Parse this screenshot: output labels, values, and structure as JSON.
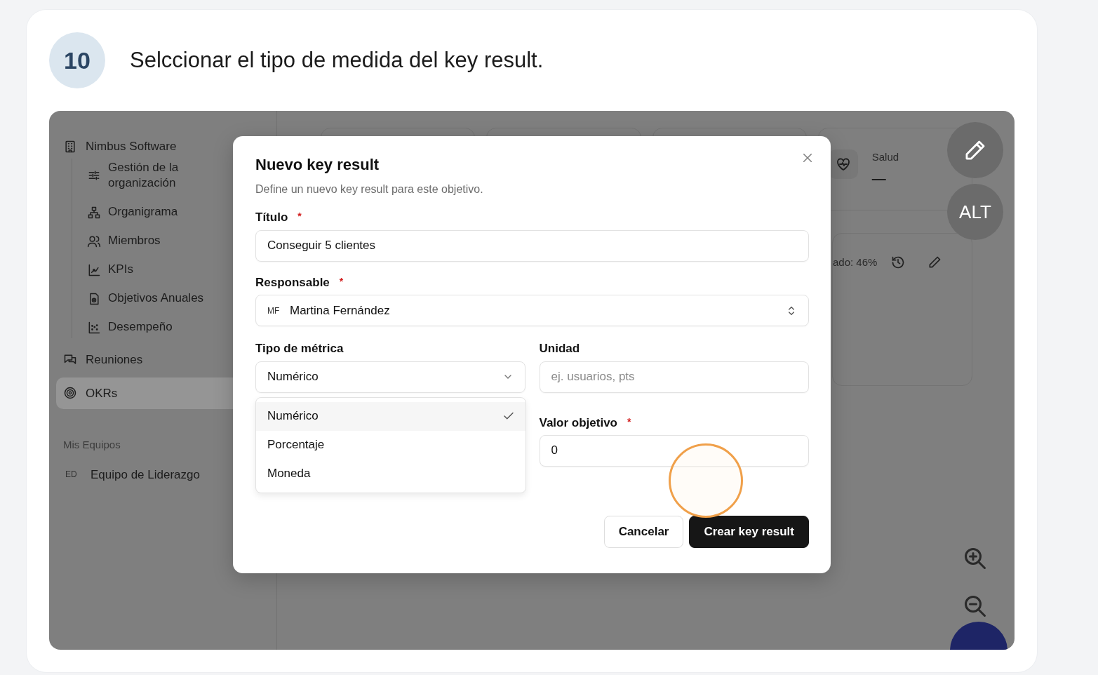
{
  "step": {
    "number": "10",
    "text": "Selccionar el tipo de medida del key result."
  },
  "sidebar": {
    "workspace": "Nimbus Software",
    "children": [
      {
        "label": "Gestión de la organización"
      },
      {
        "label": "Organigrama"
      },
      {
        "label": "Miembros"
      },
      {
        "label": "KPIs"
      },
      {
        "label": "Objetivos Anuales"
      },
      {
        "label": "Desempeño"
      }
    ],
    "items": [
      {
        "label": "Reuniones",
        "selected": false
      },
      {
        "label": "OKRs",
        "selected": true
      }
    ],
    "section": "Mis Equipos",
    "teams": [
      {
        "initials": "ED",
        "name": "Equipo de Liderazgo"
      }
    ]
  },
  "background": {
    "health_label": "Salud",
    "health_value": "—",
    "progress_text": "ado: 46%"
  },
  "modal": {
    "title": "Nuevo key result",
    "subtitle": "Define un nuevo key result para este objetivo.",
    "title_field": {
      "label": "Título",
      "required_mark": "*",
      "value": "Conseguir 5 clientes"
    },
    "owner_field": {
      "label": "Responsable",
      "required_mark": "*",
      "initials": "MF",
      "value": "Martina Fernández"
    },
    "metric_field": {
      "label": "Tipo de métrica",
      "value": "Numérico",
      "expanded": true,
      "options": [
        {
          "label": "Numérico",
          "selected": true
        },
        {
          "label": "Porcentaje",
          "selected": false
        },
        {
          "label": "Moneda",
          "selected": false
        }
      ]
    },
    "unit_field": {
      "label": "Unidad",
      "placeholder": "ej. usuarios, pts"
    },
    "target_field": {
      "label": "Valor objetivo",
      "required_mark": "*",
      "value": "0"
    },
    "buttons": [
      {
        "label": "Cancelar",
        "kind": "secondary"
      },
      {
        "label": "Crear key result",
        "kind": "primary"
      }
    ]
  },
  "floating": {
    "alt_label": "ALT"
  }
}
